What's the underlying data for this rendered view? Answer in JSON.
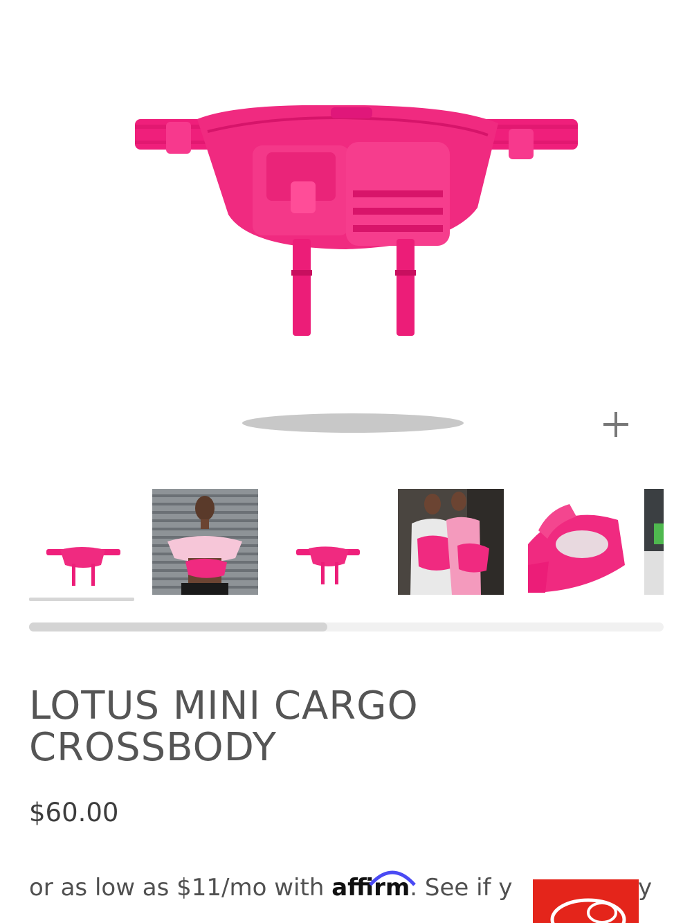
{
  "product": {
    "title_line1": "LOTUS MINI CARGO",
    "title_line2": "CROSSBODY",
    "price": "$60.00"
  },
  "financing": {
    "prefix": "or as low as $11/mo with",
    "provider": "affirm",
    "suffix": ". See if y",
    "tail": "y"
  },
  "gallery": {
    "zoom_icon": "plus-icon",
    "thumbnails": [
      {
        "name": "thumb-product-front",
        "active": true
      },
      {
        "name": "thumb-model-street",
        "active": false
      },
      {
        "name": "thumb-product-side",
        "active": false
      },
      {
        "name": "thumb-two-models",
        "active": false
      },
      {
        "name": "thumb-product-open",
        "active": false
      },
      {
        "name": "thumb-partial",
        "active": false
      }
    ],
    "scroll_progress": 0.47
  },
  "colors": {
    "product_pink": "#f0237d",
    "chat_red": "#e4251b",
    "affirm_blue": "#4a4af4"
  }
}
